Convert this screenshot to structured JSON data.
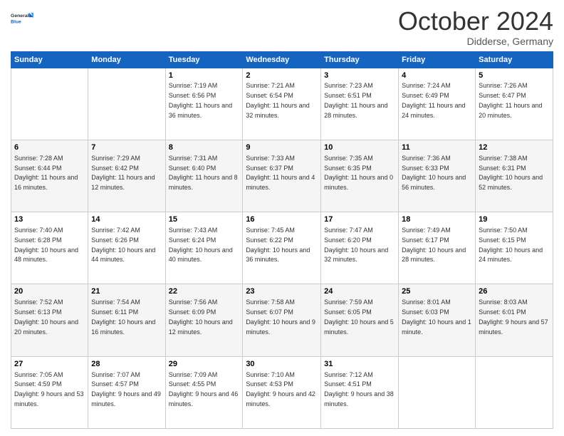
{
  "header": {
    "logo_general": "General",
    "logo_blue": "Blue",
    "month_title": "October 2024",
    "location": "Didderse, Germany"
  },
  "days_of_week": [
    "Sunday",
    "Monday",
    "Tuesday",
    "Wednesday",
    "Thursday",
    "Friday",
    "Saturday"
  ],
  "weeks": [
    [
      null,
      null,
      {
        "day": "1",
        "sunrise": "7:19 AM",
        "sunset": "6:56 PM",
        "daylight": "11 hours and 36 minutes."
      },
      {
        "day": "2",
        "sunrise": "7:21 AM",
        "sunset": "6:54 PM",
        "daylight": "11 hours and 32 minutes."
      },
      {
        "day": "3",
        "sunrise": "7:23 AM",
        "sunset": "6:51 PM",
        "daylight": "11 hours and 28 minutes."
      },
      {
        "day": "4",
        "sunrise": "7:24 AM",
        "sunset": "6:49 PM",
        "daylight": "11 hours and 24 minutes."
      },
      {
        "day": "5",
        "sunrise": "7:26 AM",
        "sunset": "6:47 PM",
        "daylight": "11 hours and 20 minutes."
      }
    ],
    [
      {
        "day": "6",
        "sunrise": "7:28 AM",
        "sunset": "6:44 PM",
        "daylight": "11 hours and 16 minutes."
      },
      {
        "day": "7",
        "sunrise": "7:29 AM",
        "sunset": "6:42 PM",
        "daylight": "11 hours and 12 minutes."
      },
      {
        "day": "8",
        "sunrise": "7:31 AM",
        "sunset": "6:40 PM",
        "daylight": "11 hours and 8 minutes."
      },
      {
        "day": "9",
        "sunrise": "7:33 AM",
        "sunset": "6:37 PM",
        "daylight": "11 hours and 4 minutes."
      },
      {
        "day": "10",
        "sunrise": "7:35 AM",
        "sunset": "6:35 PM",
        "daylight": "11 hours and 0 minutes."
      },
      {
        "day": "11",
        "sunrise": "7:36 AM",
        "sunset": "6:33 PM",
        "daylight": "10 hours and 56 minutes."
      },
      {
        "day": "12",
        "sunrise": "7:38 AM",
        "sunset": "6:31 PM",
        "daylight": "10 hours and 52 minutes."
      }
    ],
    [
      {
        "day": "13",
        "sunrise": "7:40 AM",
        "sunset": "6:28 PM",
        "daylight": "10 hours and 48 minutes."
      },
      {
        "day": "14",
        "sunrise": "7:42 AM",
        "sunset": "6:26 PM",
        "daylight": "10 hours and 44 minutes."
      },
      {
        "day": "15",
        "sunrise": "7:43 AM",
        "sunset": "6:24 PM",
        "daylight": "10 hours and 40 minutes."
      },
      {
        "day": "16",
        "sunrise": "7:45 AM",
        "sunset": "6:22 PM",
        "daylight": "10 hours and 36 minutes."
      },
      {
        "day": "17",
        "sunrise": "7:47 AM",
        "sunset": "6:20 PM",
        "daylight": "10 hours and 32 minutes."
      },
      {
        "day": "18",
        "sunrise": "7:49 AM",
        "sunset": "6:17 PM",
        "daylight": "10 hours and 28 minutes."
      },
      {
        "day": "19",
        "sunrise": "7:50 AM",
        "sunset": "6:15 PM",
        "daylight": "10 hours and 24 minutes."
      }
    ],
    [
      {
        "day": "20",
        "sunrise": "7:52 AM",
        "sunset": "6:13 PM",
        "daylight": "10 hours and 20 minutes."
      },
      {
        "day": "21",
        "sunrise": "7:54 AM",
        "sunset": "6:11 PM",
        "daylight": "10 hours and 16 minutes."
      },
      {
        "day": "22",
        "sunrise": "7:56 AM",
        "sunset": "6:09 PM",
        "daylight": "10 hours and 12 minutes."
      },
      {
        "day": "23",
        "sunrise": "7:58 AM",
        "sunset": "6:07 PM",
        "daylight": "10 hours and 9 minutes."
      },
      {
        "day": "24",
        "sunrise": "7:59 AM",
        "sunset": "6:05 PM",
        "daylight": "10 hours and 5 minutes."
      },
      {
        "day": "25",
        "sunrise": "8:01 AM",
        "sunset": "6:03 PM",
        "daylight": "10 hours and 1 minute."
      },
      {
        "day": "26",
        "sunrise": "8:03 AM",
        "sunset": "6:01 PM",
        "daylight": "9 hours and 57 minutes."
      }
    ],
    [
      {
        "day": "27",
        "sunrise": "7:05 AM",
        "sunset": "4:59 PM",
        "daylight": "9 hours and 53 minutes."
      },
      {
        "day": "28",
        "sunrise": "7:07 AM",
        "sunset": "4:57 PM",
        "daylight": "9 hours and 49 minutes."
      },
      {
        "day": "29",
        "sunrise": "7:09 AM",
        "sunset": "4:55 PM",
        "daylight": "9 hours and 46 minutes."
      },
      {
        "day": "30",
        "sunrise": "7:10 AM",
        "sunset": "4:53 PM",
        "daylight": "9 hours and 42 minutes."
      },
      {
        "day": "31",
        "sunrise": "7:12 AM",
        "sunset": "4:51 PM",
        "daylight": "9 hours and 38 minutes."
      },
      null,
      null
    ]
  ]
}
